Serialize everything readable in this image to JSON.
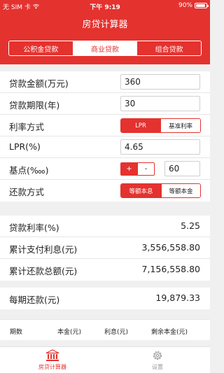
{
  "status_bar": {
    "carrier": "无 SIM 卡",
    "time": "下午 9:19",
    "battery": "90%"
  },
  "header": {
    "title": "房贷计算器"
  },
  "tabs": [
    {
      "label": "公积金贷款",
      "active": false
    },
    {
      "label": "商业贷款",
      "active": true
    },
    {
      "label": "组合贷款",
      "active": false
    }
  ],
  "form": {
    "loan_amount": {
      "label": "贷款金额(万元)",
      "value": "360"
    },
    "loan_term": {
      "label": "贷款期限(年)",
      "value": "30"
    },
    "rate_mode": {
      "label": "利率方式",
      "options": [
        "LPR",
        "基准利率"
      ],
      "selected": "LPR"
    },
    "lpr": {
      "label": "LPR(%)",
      "value": "4.65"
    },
    "basis_points": {
      "label": "基点(‱)",
      "plus": "+",
      "minus": "-",
      "value": "60"
    },
    "repay_method": {
      "label": "还款方式",
      "options": [
        "等额本息",
        "等额本金"
      ],
      "selected": "等额本息"
    }
  },
  "results": {
    "loan_rate": {
      "label": "贷款利率(%)",
      "value": "5.25"
    },
    "total_interest": {
      "label": "累计支付利息(元)",
      "value": "3,556,558.80"
    },
    "total_repayment": {
      "label": "累计还款总额(元)",
      "value": "7,156,558.80"
    }
  },
  "monthly": {
    "label": "每期还款(元)",
    "value": "19,879.33"
  },
  "schedule_headers": [
    "期数",
    "本金(元)",
    "利息(元)",
    "剩余本金(元)"
  ],
  "tabbar": [
    {
      "label": "房贷计算器",
      "icon": "bank-icon",
      "active": true
    },
    {
      "label": "设置",
      "icon": "gear-icon",
      "active": false
    }
  ],
  "colors": {
    "accent": "#e4322f",
    "background": "#f0f0f0"
  }
}
